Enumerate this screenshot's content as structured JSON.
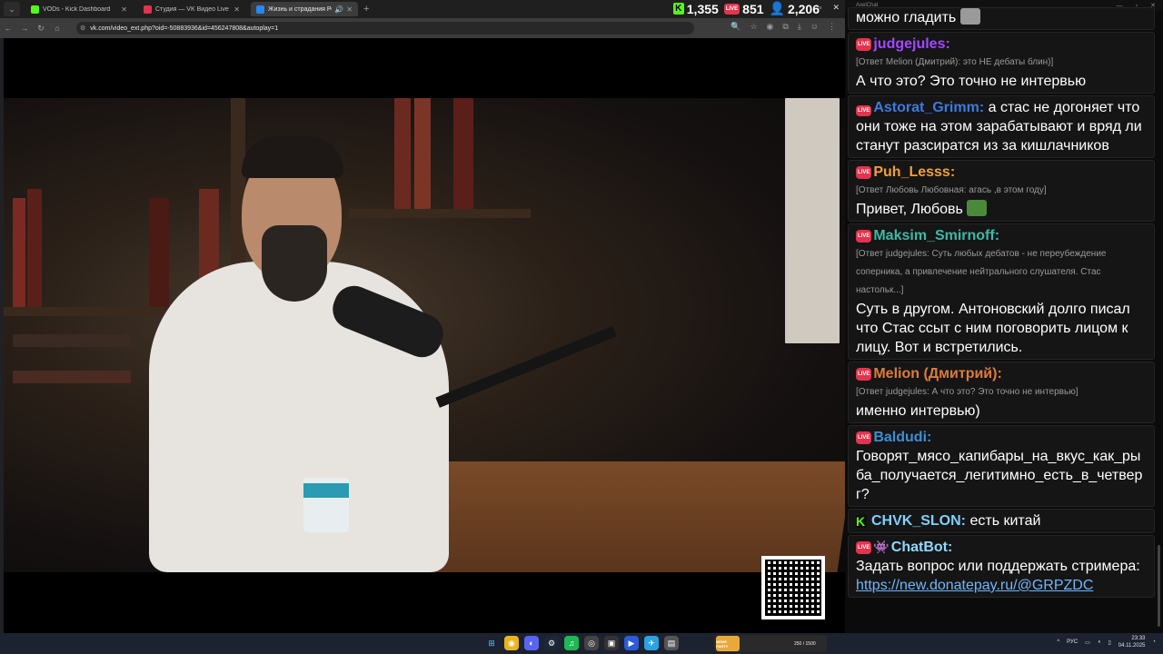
{
  "browser": {
    "tabs": [
      {
        "title": "VODs - Kick Dashboard",
        "favicon_color": "#53fc18",
        "active": false
      },
      {
        "title": "Студия — VK Видео Live",
        "favicon_color": "#e3344d",
        "active": false
      },
      {
        "title": "Жизнь и страдания Рома...",
        "favicon_color": "#2787f5",
        "active": true
      }
    ],
    "url": "vk.com/video_ext.php?oid=-50883936&id=456247808&autoplay=1"
  },
  "stats": {
    "kick_viewers": "1,355",
    "vk_viewers": "851",
    "total_viewers": "2,206"
  },
  "chat": {
    "window_title": "AxelChat",
    "top_partial_text": "можно гладить",
    "messages": [
      {
        "platform": "vk",
        "user": "judgejules:",
        "color": "#a347ff",
        "reply": "[Ответ Melion (Дмитрий): это НЕ дебаты блин)]",
        "text": "А что это? Это точно не интервью"
      },
      {
        "platform": "vk",
        "user": "Astorat_Grimm:",
        "color": "#3b7be0",
        "reply": "",
        "text": "а стас не догоняет что они тоже на этом зарабатывают и вряд ли станут разсиратся из за кишлачников"
      },
      {
        "platform": "vk",
        "user": "Puh_Lesss:",
        "color": "#f0a03a",
        "reply": "[Ответ Любовь Любовная: агась ,в этом году]",
        "text": "Привет, Любовь"
      },
      {
        "platform": "vk",
        "user": "Maksim_Smirnoff:",
        "color": "#3fb8a6",
        "reply": "[Ответ judgejules: Суть любых дебатов - не переубеждение соперника, а привлечение нейтрального слушателя. Стас настольк...]",
        "text": "Суть в другом. Антоновский долго писал что Стас ссыт с ним поговорить лицом к лицу. Вот и встретились."
      },
      {
        "platform": "vk",
        "user": "Melion (Дмитрий):",
        "color": "#e07a3a",
        "reply": "[Ответ judgejules: А что это? Это точно не интервью]",
        "text": "именно интервью)"
      },
      {
        "platform": "vk",
        "user": "Baldudi:",
        "color": "#3b8fd6",
        "reply": "",
        "text": "Говорят_мясо_капибары_на_вкус_как_рыба_получается_легитимно_есть_в_четверг?"
      },
      {
        "platform": "kick",
        "user": "CHVK_SLON:",
        "color": "#7fd0ff",
        "reply": "",
        "text": "есть китай"
      },
      {
        "platform": "vk",
        "user": "ChatBot:",
        "color": "#8fd9ff",
        "reply": "",
        "text": "Задать вопрос или поддержать стримера:",
        "link": "https://new.donatepay.ru/@GRPZDC"
      }
    ]
  },
  "taskbar": {
    "media_label": "MEME PARTY",
    "media_progress": "250 / 1500",
    "lang": "РУС",
    "time": "23:33",
    "date": "04.11.2025"
  }
}
